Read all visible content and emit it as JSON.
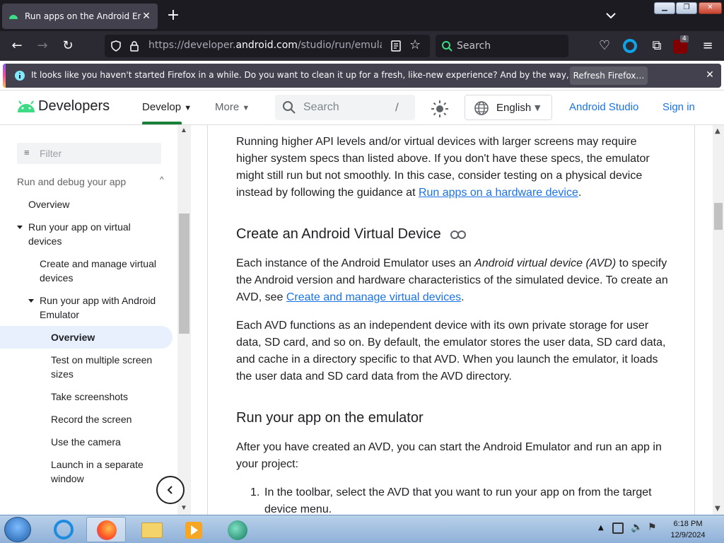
{
  "browser": {
    "tab_title": "Run apps on the Android Emul",
    "url_dim": "https://developer.",
    "url_host": "android.com",
    "url_rest": "/studio/run/emulator#av",
    "search_label": "Search",
    "extension_badge": "4"
  },
  "notification": {
    "text": "It looks like you haven't started Firefox in a while. Do you want to clean it up for a fresh, like-new experience? And by the way, welcome back!",
    "button": "Refresh Firefox…"
  },
  "site_header": {
    "logo": "Developers",
    "nav_develop": "Develop",
    "nav_more": "More",
    "search_placeholder": "Search",
    "search_shortcut": "/",
    "language": "English",
    "link_studio": "Android Studio",
    "link_signin": "Sign in"
  },
  "sidebar": {
    "filter_placeholder": "Filter",
    "section": "Run and debug your app",
    "items": [
      {
        "label": "Overview"
      },
      {
        "label": "Run your app on virtual devices"
      },
      {
        "label": "Create and manage virtual devices"
      },
      {
        "label": "Run your app with Android Emulator"
      },
      {
        "label": "Overview"
      },
      {
        "label": "Test on multiple screen sizes"
      },
      {
        "label": "Take screenshots"
      },
      {
        "label": "Record the screen"
      },
      {
        "label": "Use the camera"
      },
      {
        "label": "Launch in a separate window"
      }
    ]
  },
  "content": {
    "p1_text": "Running higher API levels and/or virtual devices with larger screens may require higher system specs than listed above. If you don't have these specs, the emulator might still run but not smoothly. In this case, consider testing on a physical device instead by following the guidance at ",
    "p1_link": "Run apps on a hardware device",
    "p1_end": ".",
    "h2_avd": "Create an Android Virtual Device",
    "p2_a": "Each instance of the Android Emulator uses an ",
    "p2_em": "Android virtual device (AVD)",
    "p2_b": " to specify the Android version and hardware characteristics of the simulated device. To create an AVD, see ",
    "p2_link": "Create and manage virtual devices",
    "p2_end": ".",
    "p3": "Each AVD functions as an independent device with its own private storage for user data, SD card, and so on. By default, the emulator stores the user data, SD card data, and cache in a directory specific to that AVD. When you launch the emulator, it loads the user data and SD card data from the AVD directory.",
    "h2_run": "Run your app on the emulator",
    "p4": "After you have created an AVD, you can start the Android Emulator and run an app in your project:",
    "li1_num": "1.",
    "li1": "In the toolbar, select the AVD that you want to run your app on from the target device menu."
  },
  "taskbar": {
    "time": "6:18 PM",
    "date": "12/9/2024"
  },
  "colors": {
    "link": "#1a73e8",
    "android_green": "#3ddc84",
    "active_nav": "#188038",
    "active_item_bg": "#e8f0fe"
  }
}
